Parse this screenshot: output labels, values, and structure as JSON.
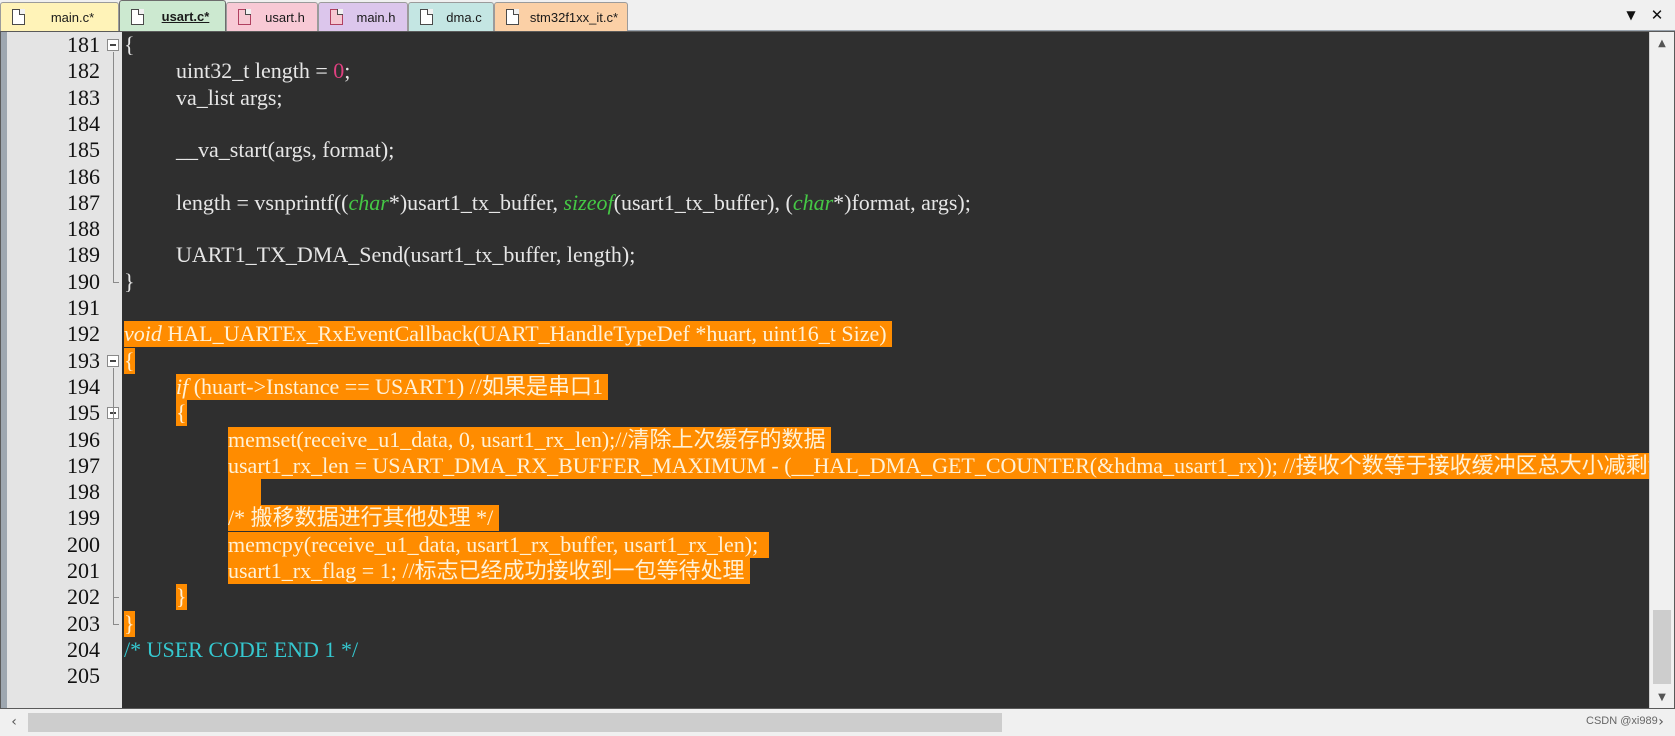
{
  "tabs": [
    {
      "label": "main.c*",
      "icon": "c-file-icon",
      "color": "#fff3b8",
      "active": false
    },
    {
      "label": "usart.c*",
      "icon": "c-file-icon",
      "color": "#cce9d0",
      "active": true
    },
    {
      "label": "usart.h",
      "icon": "h-file-icon",
      "color": "#f8c9d5",
      "active": false
    },
    {
      "label": "main.h",
      "icon": "h-file-icon",
      "color": "#dcc6ec",
      "active": false
    },
    {
      "label": "dma.c",
      "icon": "c-file-icon",
      "color": "#c4e6e3",
      "active": false
    },
    {
      "label": "stm32f1xx_it.c*",
      "icon": "c-file-icon",
      "color": "#fbd0a6",
      "active": false
    }
  ],
  "tab_controls": {
    "list_arrow": "▼",
    "close": "✕"
  },
  "editor": {
    "colors": {
      "background": "#2f2f2f",
      "selection": "#ff8c00",
      "keyword": "#45c845",
      "number": "#e04080",
      "comment": "#35c8d0"
    },
    "fold_markers": [
      181,
      193,
      195
    ],
    "lines": [
      {
        "num": "181",
        "indent": 0,
        "sel": false,
        "tokens": [
          {
            "t": "{",
            "c": ""
          }
        ]
      },
      {
        "num": "182",
        "indent": 1,
        "sel": false,
        "tokens": [
          {
            "t": "uint32_t length = ",
            "c": ""
          },
          {
            "t": "0",
            "c": "num"
          },
          {
            "t": ";",
            "c": ""
          }
        ]
      },
      {
        "num": "183",
        "indent": 1,
        "sel": false,
        "tokens": [
          {
            "t": "va_list args;",
            "c": ""
          }
        ]
      },
      {
        "num": "184",
        "indent": 0,
        "sel": false,
        "tokens": []
      },
      {
        "num": "185",
        "indent": 1,
        "sel": false,
        "tokens": [
          {
            "t": "__va_start(args, format);",
            "c": ""
          }
        ]
      },
      {
        "num": "186",
        "indent": 0,
        "sel": false,
        "tokens": []
      },
      {
        "num": "187",
        "indent": 1,
        "sel": false,
        "tokens": [
          {
            "t": "length = vsnprintf((",
            "c": ""
          },
          {
            "t": "char",
            "c": "kw"
          },
          {
            "t": "*)usart1_tx_buffer, ",
            "c": ""
          },
          {
            "t": "sizeof",
            "c": "kw"
          },
          {
            "t": "(usart1_tx_buffer), (",
            "c": ""
          },
          {
            "t": "char",
            "c": "kw"
          },
          {
            "t": "*)format, args);",
            "c": ""
          }
        ]
      },
      {
        "num": "188",
        "indent": 0,
        "sel": false,
        "tokens": []
      },
      {
        "num": "189",
        "indent": 1,
        "sel": false,
        "tokens": [
          {
            "t": "UART1_TX_DMA_Send(usart1_tx_buffer, length);",
            "c": ""
          }
        ]
      },
      {
        "num": "190",
        "indent": 0,
        "sel": false,
        "tokens": [
          {
            "t": "}",
            "c": ""
          }
        ]
      },
      {
        "num": "191",
        "indent": 0,
        "sel": false,
        "tokens": []
      },
      {
        "num": "192",
        "indent": 0,
        "sel": true,
        "tokens": [
          {
            "t": "void",
            "c": "kw"
          },
          {
            "t": " HAL_UARTEx_RxEventCallback(UART_HandleTypeDef *huart, uint16_t Size) ",
            "c": ""
          }
        ]
      },
      {
        "num": "193",
        "indent": 0,
        "sel": true,
        "tokens": [
          {
            "t": "{",
            "c": ""
          }
        ]
      },
      {
        "num": "194",
        "indent": 1,
        "sel": true,
        "tokens": [
          {
            "t": "if",
            "c": "kw"
          },
          {
            "t": " (huart->Instance == USART1) //如果是串口1 ",
            "c": ""
          }
        ]
      },
      {
        "num": "195",
        "indent": 1,
        "sel": true,
        "tokens": [
          {
            "t": "{",
            "c": ""
          }
        ]
      },
      {
        "num": "196",
        "indent": 2,
        "sel": true,
        "tokens": [
          {
            "t": "memset(receive_u1_data, 0, usart1_rx_len);//清除上次缓存的数据 ",
            "c": ""
          }
        ]
      },
      {
        "num": "197",
        "indent": 2,
        "sel": true,
        "tokens": [
          {
            "t": "usart1_rx_len = USART_DMA_RX_BUFFER_MAXIMUM - (__HAL_DMA_GET_COUNTER(&hdma_usart1_rx)); //接收个数等于接收缓冲区总大小减剩余计数",
            "c": ""
          }
        ]
      },
      {
        "num": "198",
        "indent": 2,
        "sel": true,
        "tokens": [
          {
            "t": "      ",
            "c": ""
          }
        ]
      },
      {
        "num": "199",
        "indent": 2,
        "sel": true,
        "tokens": [
          {
            "t": "/* 搬移数据进行其他处理 */ ",
            "c": ""
          }
        ]
      },
      {
        "num": "200",
        "indent": 2,
        "sel": true,
        "tokens": [
          {
            "t": "memcpy(receive_u1_data, usart1_rx_buffer, usart1_rx_len);  ",
            "c": ""
          }
        ]
      },
      {
        "num": "201",
        "indent": 2,
        "sel": true,
        "tokens": [
          {
            "t": "usart1_rx_flag = 1; //标志已经成功接收到一包等待处理 ",
            "c": ""
          }
        ]
      },
      {
        "num": "202",
        "indent": 1,
        "sel": true,
        "tokens": [
          {
            "t": "}",
            "c": ""
          }
        ]
      },
      {
        "num": "203",
        "indent": 0,
        "sel": true,
        "tokens": [
          {
            "t": "}",
            "c": ""
          }
        ]
      },
      {
        "num": "204",
        "indent": 0,
        "sel": false,
        "tokens": [
          {
            "t": "/* USER CODE END 1 */",
            "c": "cm"
          }
        ]
      },
      {
        "num": "205",
        "indent": 0,
        "sel": false,
        "tokens": []
      }
    ]
  },
  "scrollbars": {
    "vertical_up": "▲",
    "vertical_down": "▼",
    "horizontal_left": "‹",
    "horizontal_right": "›"
  },
  "watermark": "CSDN @xi989"
}
